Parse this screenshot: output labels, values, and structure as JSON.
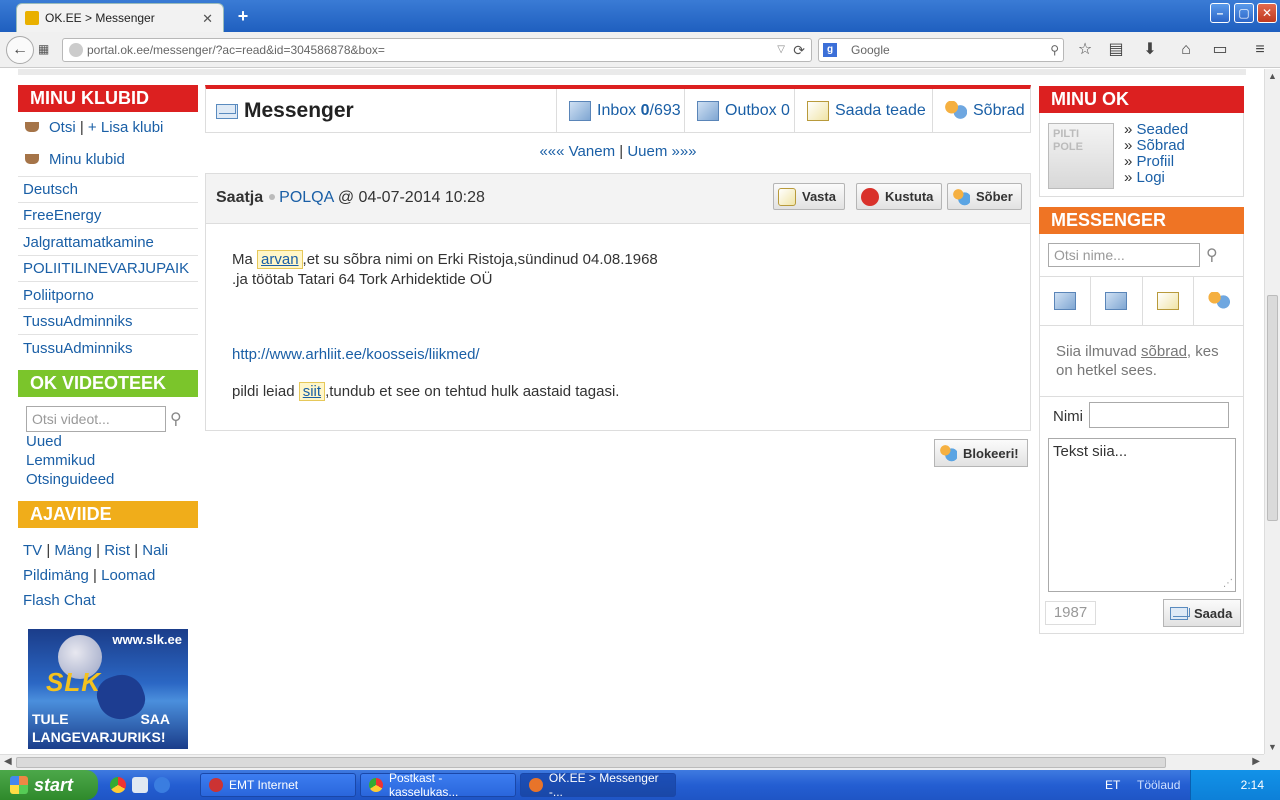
{
  "browser": {
    "tab_title": "OK.EE > Messenger",
    "new_tab": "+",
    "url": "portal.ok.ee/messenger/?ac=read&id=304586878&box=",
    "search_placeholder": "Google"
  },
  "left": {
    "clubs_title": "MINU KLUBID",
    "search_link": "Otsi",
    "add_club_link": "+ Lisa klubi",
    "my_clubs_link": "Minu klubid",
    "clubs": [
      "Deutsch",
      "FreeEnergy",
      "Jalgrattamatkamine",
      "POLIITILINEVARJUPAIK",
      "Poliitporno",
      "TussuAdminniks",
      "TussuAdminniks"
    ],
    "video_title": "OK VIDEOTEEK",
    "video_placeholder": "Otsi videot...",
    "video_links": [
      "Uued",
      "Lemmikud",
      "Otsinguideed"
    ],
    "time_title": "AJAVIIDE",
    "time_row1": [
      "TV",
      "Mäng",
      "Rist",
      "Nali"
    ],
    "time_row2": [
      "Pildimäng",
      "Loomad"
    ],
    "time_row3": "Flash Chat",
    "banner": {
      "url": "www.slk.ee",
      "logo": "SLK",
      "line1_left": "TULE",
      "line1_right": "SAA",
      "line2": "LANGEVARJURIKS!"
    }
  },
  "header": {
    "title": "Messenger",
    "inbox_label": "Inbox",
    "inbox_unread": "0",
    "inbox_total": "/693",
    "outbox_label": "Outbox 0",
    "send_label": "Saada teade",
    "friends_label": "Sõbrad"
  },
  "pager": {
    "older": "««« Vanem",
    "newer": "Uuem »»»"
  },
  "message": {
    "sender_label": "Saatja",
    "sender_name": "POLQA",
    "at": "@",
    "datetime": "04-07-2014 10:28",
    "reply_btn": "Vasta",
    "delete_btn": "Kustuta",
    "friend_btn": "Sõber",
    "line1_pre": "Ma",
    "line1_hl": "arvan",
    "line1_post": ",et su sõbra nimi on Erki Ristoja,sündinud 04.08.1968",
    "line2": ".ja töötab Tatari 64 Tork Arhidektide OÜ",
    "url": "http://www.arhliit.ee/koosseis/liikmed/",
    "line3_pre": "pildi leiad",
    "line3_hl": "siit",
    "line3_post": ",tundub et see on tehtud hulk aastaid tagasi.",
    "block_btn": "Blokeeri!"
  },
  "right": {
    "ok_title": "MINU OK",
    "avatar_text": "PILTI POLE",
    "ok_links": [
      "Seaded",
      "Sõbrad",
      "Profiil",
      "Logi"
    ],
    "messenger_title": "MESSENGER",
    "name_search_placeholder": "Otsi nime...",
    "note_pre": "Siia ilmuvad",
    "note_link": "sõbrad",
    "note_post": ", kes on hetkel sees.",
    "name_label": "Nimi",
    "textarea_text": "Tekst siia...",
    "char_count": "1987",
    "send_btn": "Saada"
  },
  "taskbar": {
    "start": "start",
    "tasks": [
      "EMT Internet",
      "Postkast - kasselukas...",
      "OK.EE > Messenger -..."
    ],
    "lang": "ET",
    "toolbar": "Töölaud",
    "clock": "2:14"
  }
}
